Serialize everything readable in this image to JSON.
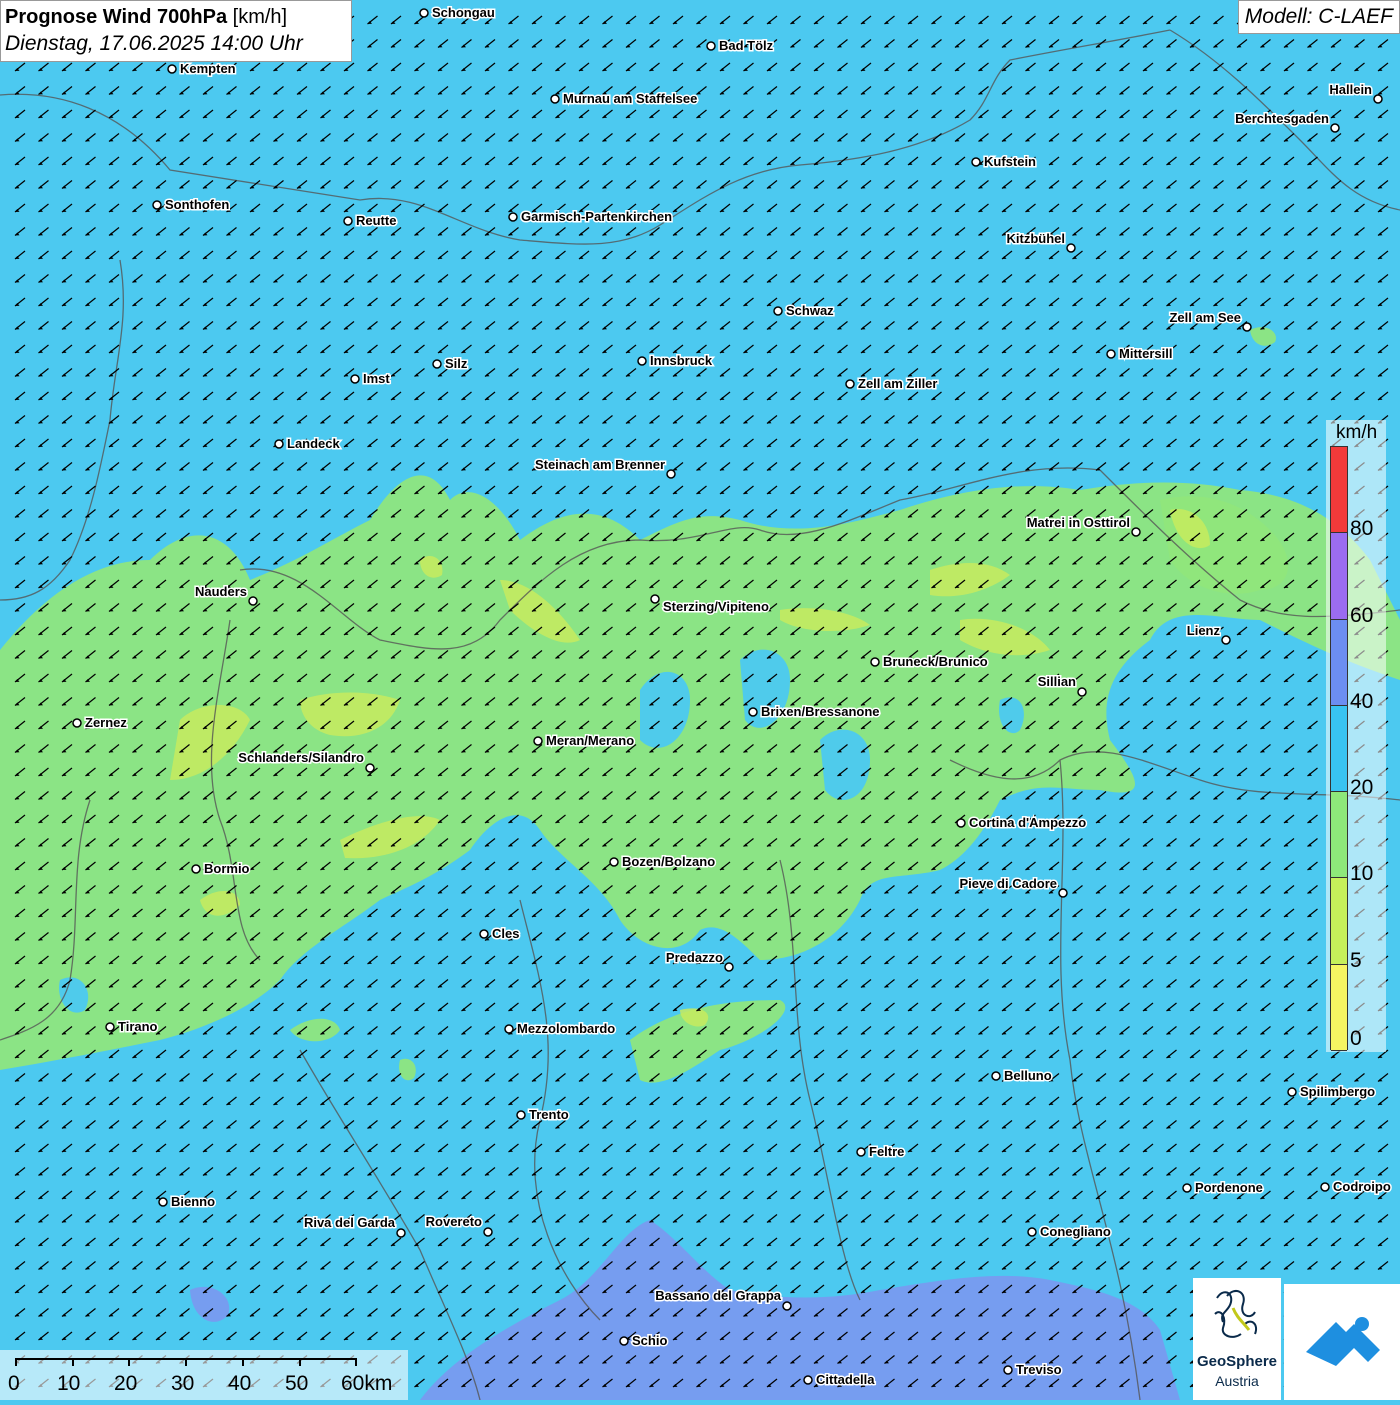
{
  "header": {
    "title_bold": "Prognose Wind 700hPa",
    "title_unit": "[km/h]",
    "subtitle": "Dienstag, 17.06.2025 14:00 Uhr",
    "model": "Modell: C-LAEF"
  },
  "legend": {
    "unit": "km/h",
    "ticks": [
      "80",
      "60",
      "40",
      "20",
      "10",
      "5",
      "0"
    ],
    "colors": [
      "#f23a3a",
      "#9b6cf0",
      "#6c8ef2",
      "#38c4f2",
      "#8ee87a",
      "#c6f05a",
      "#f6f562"
    ]
  },
  "scale": {
    "labels": [
      "0",
      "10",
      "20",
      "30",
      "40",
      "50",
      "60km"
    ]
  },
  "logos": {
    "geosphere_line1": "GeoSphere",
    "geosphere_line2": "Austria"
  },
  "colors": {
    "background_20_40": "#4cc9f0",
    "zone_10_20": "#90e67c",
    "zone_5_10": "#c7eb5e",
    "zone_40_60": "#7b98f0"
  },
  "cities": [
    {
      "name": "Schongau"
    },
    {
      "name": "Kempten"
    },
    {
      "name": "Bad Tölz"
    },
    {
      "name": "Murnau am Staffelsee"
    },
    {
      "name": "Hallein"
    },
    {
      "name": "Berchtesgaden"
    },
    {
      "name": "Kufstein"
    },
    {
      "name": "Sonthofen"
    },
    {
      "name": "Reutte"
    },
    {
      "name": "Garmisch-Partenkirchen"
    },
    {
      "name": "Kitzbühel"
    },
    {
      "name": "Schwaz"
    },
    {
      "name": "Zell am See"
    },
    {
      "name": "Mittersill"
    },
    {
      "name": "Imst"
    },
    {
      "name": "Silz"
    },
    {
      "name": "Innsbruck"
    },
    {
      "name": "Zell am Ziller"
    },
    {
      "name": "Landeck"
    },
    {
      "name": "Steinach am Brenner"
    },
    {
      "name": "Matrei in Osttirol"
    },
    {
      "name": "Nauders"
    },
    {
      "name": "Sterzing/Vipiteno"
    },
    {
      "name": "Lienz"
    },
    {
      "name": "Bruneck/Brunico"
    },
    {
      "name": "Sillian"
    },
    {
      "name": "Zernez"
    },
    {
      "name": "Brixen/Bressanone"
    },
    {
      "name": "Meran/Merano"
    },
    {
      "name": "Schlanders/Silandro"
    },
    {
      "name": "Cortina d'Ampezzo"
    },
    {
      "name": "Bormio"
    },
    {
      "name": "Bozen/Bolzano"
    },
    {
      "name": "Pieve di Cadore"
    },
    {
      "name": "Cles"
    },
    {
      "name": "Predazzo"
    },
    {
      "name": "Tirano"
    },
    {
      "name": "Mezzolombardo"
    },
    {
      "name": "Belluno"
    },
    {
      "name": "Spilimbergo"
    },
    {
      "name": "Trento"
    },
    {
      "name": "Feltre"
    },
    {
      "name": "Pordenone"
    },
    {
      "name": "Codroipo"
    },
    {
      "name": "Bienno"
    },
    {
      "name": "Riva del Garda"
    },
    {
      "name": "Rovereto"
    },
    {
      "name": "Conegliano"
    },
    {
      "name": "Bassano del Grappa"
    },
    {
      "name": "Schio"
    },
    {
      "name": "Treviso"
    },
    {
      "name": "Cittadella"
    }
  ]
}
